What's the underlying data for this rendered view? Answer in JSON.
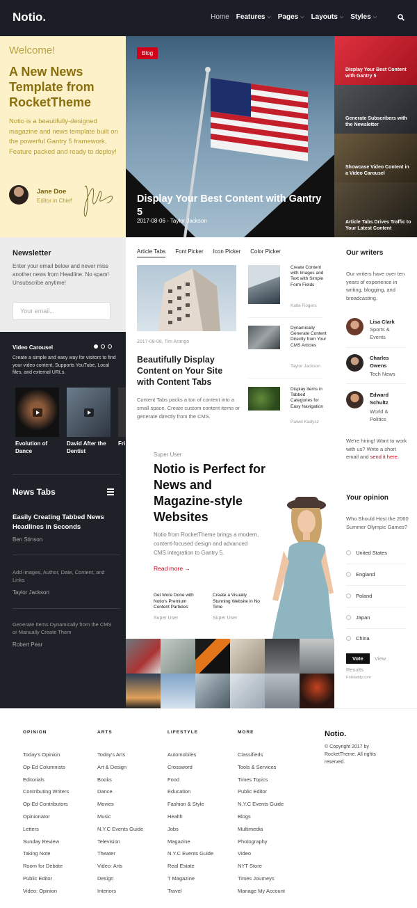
{
  "header": {
    "logo": "Notio.",
    "nav": [
      {
        "label": "Home",
        "dropdown": false
      },
      {
        "label": "Features",
        "dropdown": true
      },
      {
        "label": "Pages",
        "dropdown": true
      },
      {
        "label": "Layouts",
        "dropdown": true
      },
      {
        "label": "Styles",
        "dropdown": true
      }
    ],
    "search_icon": "search-icon"
  },
  "welcome": {
    "kicker": "Welcome!",
    "title": "A New News Template from RocketTheme",
    "description": "Notio is a beautifully-designed magazine and news template built on the powerful Gantry 5 framework. Feature packed and ready to deploy!",
    "author_name": "Jane Doe",
    "author_role": "Editor in Chief"
  },
  "hero": {
    "badge": "Blog",
    "title": "Display Your Best Content with Gantry 5",
    "meta": "2017-08-06 - Taylor Jackson"
  },
  "right_stack": [
    "Display Your Best Content with Gantry 5",
    "Generate Subscribers with the Newsletter",
    "Showcase Video Content in a Video Carousel",
    "Article Tabs Drives Traffic to Your Latest Content"
  ],
  "newsletter": {
    "title": "Newsletter",
    "description": "Enter your email below and never miss another news from Headline. No spam! Unsubscribe anytime!",
    "placeholder": "Your email..."
  },
  "video_carousel": {
    "title": "Video Carousel",
    "description": "Create a simple and easy way for visitors to find your video content, Supports YouTube, Local files, and external URLs.",
    "items": [
      "Evolution of Dance",
      "David After the Dentist",
      "Fri"
    ]
  },
  "news_tabs": {
    "title": "News Tabs",
    "items": [
      {
        "headline": "Easily Creating Tabbed News Headlines in Seconds",
        "author": "Ben Stinson"
      },
      {
        "headline": "Add Images, Author, Date, Content, and Links",
        "author": "Taylor Jackson"
      },
      {
        "headline": "Generate Items Dynamically from the CMS or Manually Create Them",
        "author": "Robert Pear"
      }
    ]
  },
  "article_tabs": {
    "tabs": [
      "Article Tabs",
      "Font Picker",
      "Icon Picker",
      "Color Picker"
    ],
    "main": {
      "meta": "2017-08-08, Tim Arango",
      "title": "Beautifully Display Content on Your Site with Content Tabs",
      "description": "Content Tabs packs a ton of content into a small space. Create custom content items or generate directly from the CMS."
    },
    "side": [
      {
        "title": "Create Content with Images and Text with Simple Form Fields",
        "author": "Katie Rogers"
      },
      {
        "title": "Dynamically Generate Content Directly from Your CMS Articles",
        "author": "Taylor Jackson"
      },
      {
        "title": "Display Items in Tabbed Categories for Easy Navigation",
        "author": "Pawel Kadysz"
      }
    ]
  },
  "writers": {
    "title": "Our writers",
    "description": "Our writers have over ten years of experience in writing, blogging, and broadcasting.",
    "list": [
      {
        "name": "Lisa Clark",
        "categories": "Sports & Events"
      },
      {
        "name": "Charles Owens",
        "categories": "Tech News"
      },
      {
        "name": "Edward Schultz",
        "categories": "World & Politics"
      }
    ],
    "hiring": "We're hiring! Want to work with us? Write a short email and",
    "hiring_link": "send it here."
  },
  "poll": {
    "title": "Your opinion",
    "question": "Who Should Host the 2060 Summer Olympic Games?",
    "options": [
      "United States",
      "England",
      "Poland",
      "Japan",
      "China"
    ],
    "vote": "Vote",
    "view": "View",
    "results": "Results",
    "credit": "Polldaddy.com"
  },
  "promo": {
    "kicker": "Super User",
    "title": "Notio is Perfect for News and Magazine-style Websites",
    "description": "Notio from RocketTheme brings a modern, content-focused design and advanced CMS integration to Gantry 5.",
    "read_more": "Read more →",
    "links": [
      {
        "title": "Get More Done with Notio's Premium Content Particles",
        "author": "Super User"
      },
      {
        "title": "Create a Visually Stunning Website in No Time",
        "author": "Super User"
      }
    ]
  },
  "footer": {
    "columns": [
      {
        "heading": "OPINION",
        "items": [
          "Today's Opinion",
          "Op-Ed Columnists",
          "Editorials",
          "Contributing Writers",
          "Op-Ed Contributors",
          "Opinionator",
          "Letters",
          "Sunday Review",
          "Taking Note",
          "Room for Debate",
          "Public Editor",
          "Video: Opinion"
        ]
      },
      {
        "heading": "ARTS",
        "items": [
          "Today's Arts",
          "Art & Design",
          "Books",
          "Dance",
          "Movies",
          "Music",
          "N.Y.C Events Guide",
          "Television",
          "Theater",
          "Video: Arts",
          "Design",
          "Interiors"
        ]
      },
      {
        "heading": "LIFESTYLE",
        "items": [
          "Automobiles",
          "Crossword",
          "Food",
          "Education",
          "Fashion & Style",
          "Health",
          "Jobs",
          "Magazine",
          "N.Y.C Events Guide",
          "Real Estate",
          "T Magazine",
          "Travel"
        ]
      },
      {
        "heading": "MORE",
        "items": [
          "Classifieds",
          "Tools & Services",
          "Times Topics",
          "Public Editor",
          "N.Y.C Events Guide",
          "Blogs",
          "Multimedia",
          "Photography",
          "Video",
          "NYT Store",
          "Times Journeys",
          "Manage My Account"
        ]
      }
    ],
    "logo": "Notio.",
    "copyright": "© Copyright 2017 by RocketTheme. All rights reserved."
  },
  "colors": {
    "accent": "#d0021b",
    "dark": "#1f2129",
    "cream": "#fcf1c8"
  }
}
